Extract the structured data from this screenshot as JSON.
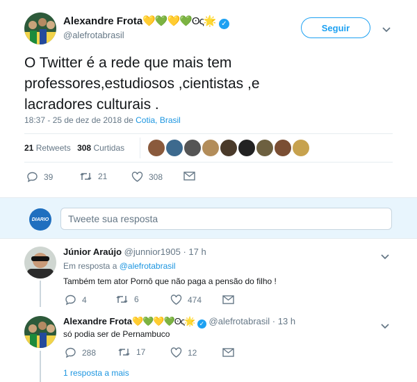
{
  "main_tweet": {
    "author_name": "Alexandre Frota",
    "author_emoji": "💛💚💛💚ʘς🌟",
    "handle": "@alefrotabrasil",
    "follow_label": "Seguir",
    "text": "O Twitter é a rede que mais tem professores,estudiosos ,cientistas ,e lacradores culturais .",
    "timestamp": "18:37 - 25 de dez de 2018 de",
    "location": "Cotia, Brasil",
    "retweets_count": "21",
    "retweets_label": "Retweets",
    "likes_count": "308",
    "likes_label": "Curtidas",
    "actions": {
      "replies": "39",
      "retweets": "21",
      "likes": "308"
    },
    "colors": {
      "accent": "#1da1f2",
      "verified": "#1da1f2"
    }
  },
  "reply_box": {
    "avatar_text": "DIARIO",
    "placeholder": "Tweete sua resposta"
  },
  "replies": [
    {
      "author_name": "Júnior Araújo",
      "handle": "@junnior1905",
      "time": "17 h",
      "in_reply_prefix": "Em resposta a",
      "in_reply_handle": "@alefrotabrasil",
      "text": "Também tem ator Pornô que não paga a pensão do filho !",
      "actions": {
        "replies": "4",
        "retweets": "6",
        "likes": "474"
      }
    },
    {
      "author_name": "Alexandre Frota",
      "author_emoji": "💛💚💛💚ʘς🌟",
      "handle": "@alefrotabrasil",
      "time": "13 h",
      "text": "só podia ser de Pernambuco",
      "actions": {
        "replies": "288",
        "retweets": "17",
        "likes": "12"
      },
      "more_replies": "1 resposta a mais"
    }
  ]
}
